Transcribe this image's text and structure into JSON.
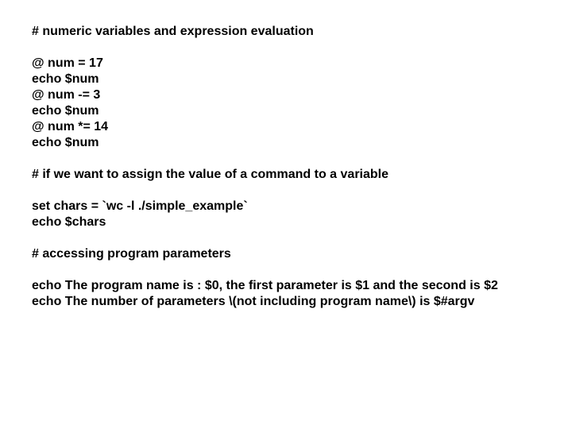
{
  "section1": {
    "comment": "# numeric variables and expression evaluation",
    "lines": [
      "@ num = 17",
      "echo $num",
      "@ num -= 3",
      "echo $num",
      "@ num *= 14",
      "echo $num"
    ]
  },
  "section2": {
    "comment": "# if we want to assign the value of a command to a variable",
    "lines": [
      "set chars = `wc -l ./simple_example`",
      "echo $chars"
    ]
  },
  "section3": {
    "comment": "# accessing program parameters",
    "lines": [
      "echo The program name is : $0, the first parameter is $1 and the second is $2",
      "echo The number of parameters \\(not including program name\\) is $#argv"
    ]
  }
}
